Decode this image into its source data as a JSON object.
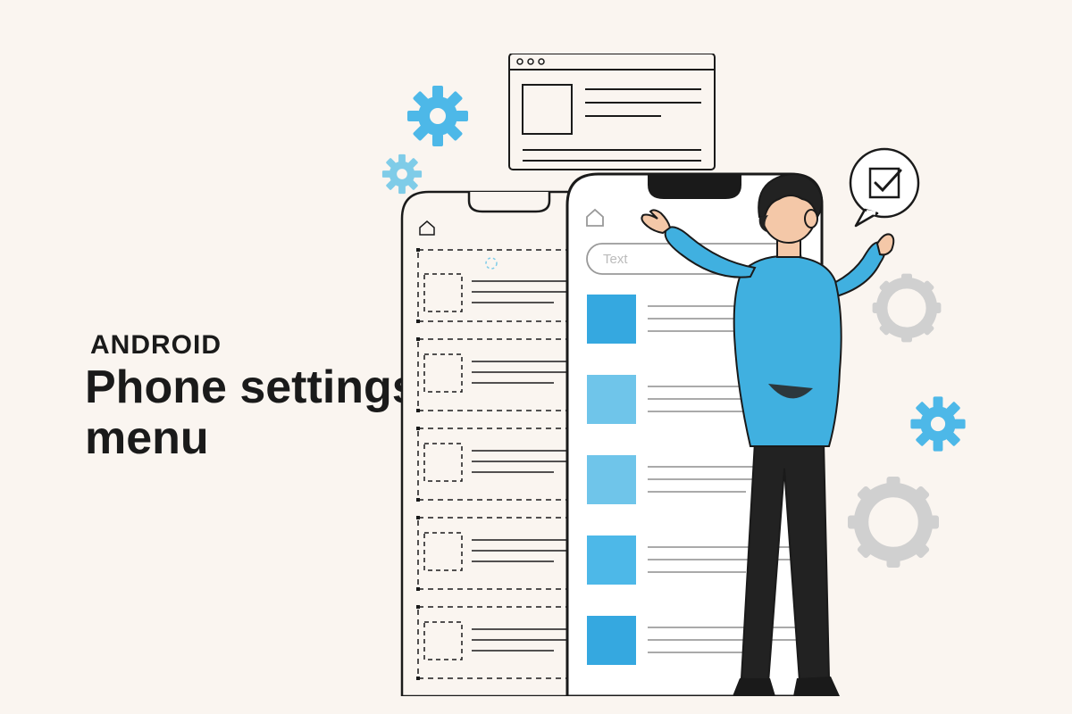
{
  "text": {
    "subtitle": "ANDROID",
    "title_line1": "Phone settings",
    "title_line2": "menu"
  },
  "search": {
    "placeholder": "Text"
  },
  "colors": {
    "bg": "#faf5f0",
    "accent_blue": "#4db8e8",
    "light_blue": "#7fcce8",
    "pale_blue": "#b3e0f0",
    "dark": "#1a1a1a",
    "hair": "#2a2a2a",
    "pants": "#2a2a2a",
    "skin": "#f4c8a8",
    "gear_light": "#d9d9d9"
  }
}
